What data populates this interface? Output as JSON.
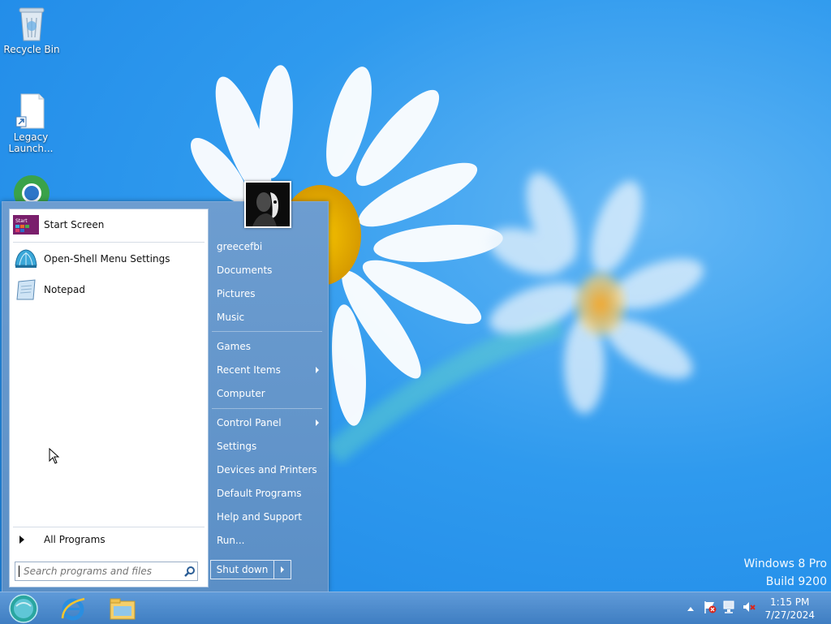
{
  "desktop": {
    "icons": [
      {
        "label": "Recycle Bin",
        "icon": "recycle-bin-icon"
      },
      {
        "label": "Legacy Launch...",
        "icon": "shortcut-file-icon"
      },
      {
        "label": "",
        "icon": "browser-icon"
      }
    ],
    "watermark": {
      "line1": "Windows 8 Pro",
      "line2": "Build 9200"
    }
  },
  "start_menu": {
    "pinned": [
      {
        "label": "Start Screen",
        "icon": "start-screen-icon"
      },
      {
        "label": "Open-Shell Menu Settings",
        "icon": "shell-settings-icon"
      },
      {
        "label": "Notepad",
        "icon": "notepad-icon"
      }
    ],
    "all_programs": "All Programs",
    "search_placeholder": "Search programs and files",
    "user": "greecefbi",
    "right_items": [
      {
        "label": "Documents",
        "submenu": false
      },
      {
        "label": "Pictures",
        "submenu": false
      },
      {
        "label": "Music",
        "submenu": false
      },
      {
        "label": "Games",
        "submenu": false
      },
      {
        "label": "Recent Items",
        "submenu": true
      },
      {
        "label": "Computer",
        "submenu": false
      },
      {
        "label": "Control Panel",
        "submenu": true
      },
      {
        "label": "Settings",
        "submenu": false
      },
      {
        "label": "Devices and Printers",
        "submenu": false
      },
      {
        "label": "Default Programs",
        "submenu": false
      },
      {
        "label": "Help and Support",
        "submenu": false
      },
      {
        "label": "Run...",
        "submenu": false
      }
    ],
    "shutdown_label": "Shut down"
  },
  "taskbar": {
    "buttons": [
      "start-orb-icon",
      "internet-explorer-icon",
      "file-explorer-icon"
    ],
    "tray_icons": [
      "show-hidden-icons-chevron",
      "action-center-flag-icon",
      "network-icon",
      "volume-muted-icon"
    ],
    "time": "1:15 PM",
    "date": "7/27/2024"
  },
  "colors": {
    "menu_blue": "#5f92c8",
    "taskbar_blue": "#4f8ccd",
    "wallpaper_blue": "#2f9aee"
  }
}
